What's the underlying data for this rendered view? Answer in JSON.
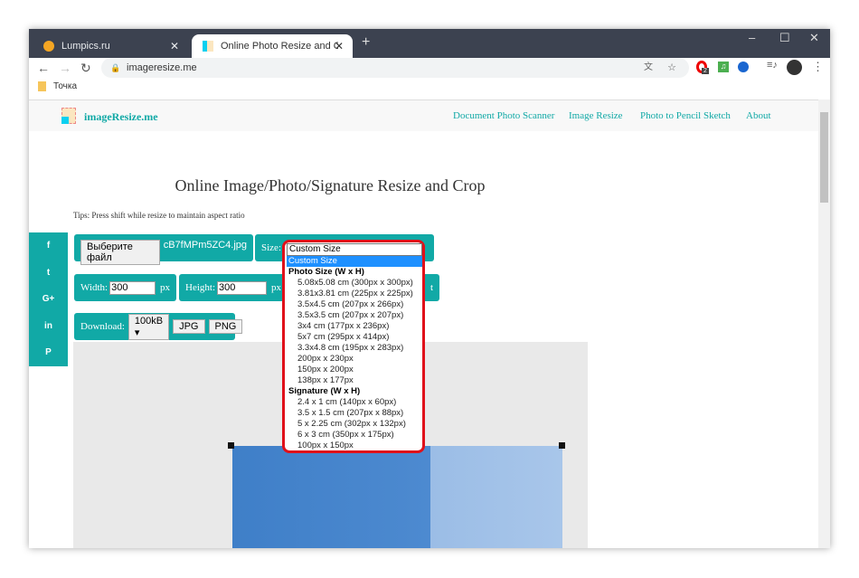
{
  "browser": {
    "tabs": [
      {
        "title": "Lumpics.ru",
        "active": false
      },
      {
        "title": "Online Photo Resize and Crop | R",
        "active": true
      }
    ],
    "url": "imageresize.me",
    "bookmark": "Точка",
    "extension_badge": "2"
  },
  "site": {
    "logo": "imageResize.me",
    "nav": [
      "Document Photo Scanner",
      "Image Resize",
      "Photo to Pencil Sketch",
      "About"
    ],
    "title": "Online Image/Photo/Signature Resize and Crop",
    "tips": "Tips: Press shift while resize to maintain aspect ratio",
    "social": [
      "f",
      "t",
      "G+",
      "in",
      "P"
    ],
    "file_button": "Выберите файл",
    "file_name": "cB7fMPm5ZC4.jpg",
    "size_label": "Size:",
    "size_value": "Custom Size",
    "width_label": "Width:",
    "width_value": "300",
    "height_label": "Height:",
    "height_value": "300",
    "px": "px",
    "hidden_button_fragment": "t",
    "download_label": "Download:",
    "download_size": "100kB ▾",
    "jpg": "JPG",
    "png": "PNG",
    "accent": "#11a9a6"
  },
  "dropdown": {
    "items": [
      {
        "label": "Custom Size",
        "type": "selected"
      },
      {
        "label": "Photo Size (W x H)",
        "type": "group"
      },
      {
        "label": "5.08x5.08 cm (300px x 300px)",
        "type": "opt"
      },
      {
        "label": "3.81x3.81 cm (225px x 225px)",
        "type": "opt"
      },
      {
        "label": "3.5x4.5 cm (207px x 266px)",
        "type": "opt"
      },
      {
        "label": "3.5x3.5 cm (207px x 207px)",
        "type": "opt"
      },
      {
        "label": "3x4 cm (177px x 236px)",
        "type": "opt"
      },
      {
        "label": "5x7 cm (295px x 414px)",
        "type": "opt"
      },
      {
        "label": "3.3x4.8 cm (195px x 283px)",
        "type": "opt"
      },
      {
        "label": "200px x 230px",
        "type": "opt"
      },
      {
        "label": "150px x 200px",
        "type": "opt"
      },
      {
        "label": "138px x 177px",
        "type": "opt"
      },
      {
        "label": "Signature (W x H)",
        "type": "group"
      },
      {
        "label": "2.4 x 1 cm (140px x 60px)",
        "type": "opt"
      },
      {
        "label": "3.5 x 1.5 cm (207px x 88px)",
        "type": "opt"
      },
      {
        "label": "5 x 2.25 cm (302px x 132px)",
        "type": "opt"
      },
      {
        "label": "6 x 3 cm (350px x 175px)",
        "type": "opt"
      },
      {
        "label": "100px x 150px",
        "type": "opt"
      }
    ]
  }
}
